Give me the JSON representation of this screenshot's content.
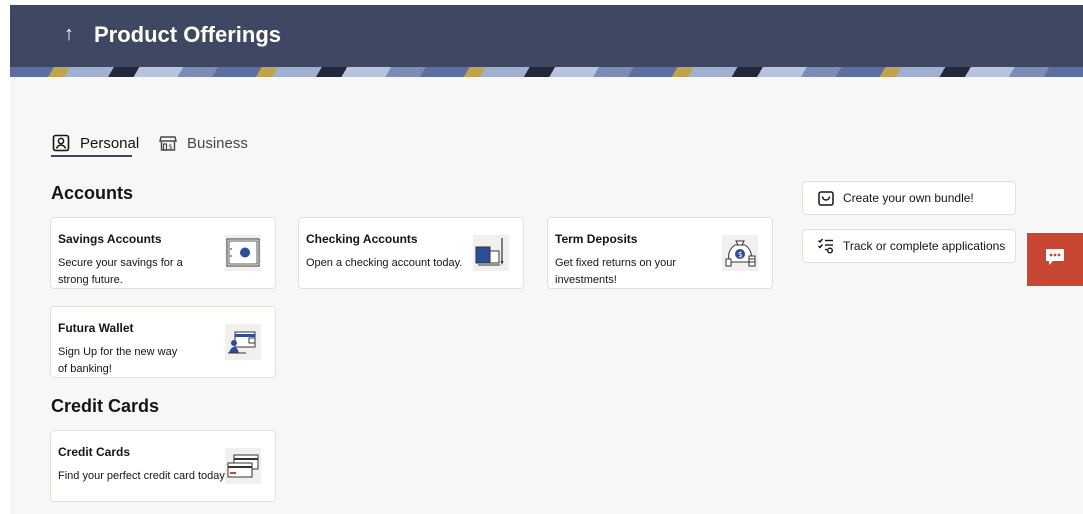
{
  "header": {
    "back_glyph": "↑",
    "title": "Product Offerings"
  },
  "tabs": [
    {
      "label": "Personal",
      "icon": "person-id-icon",
      "selected": true
    },
    {
      "label": "Business",
      "icon": "storefront-icon",
      "selected": false
    }
  ],
  "sections": [
    {
      "title": "Accounts",
      "cards": [
        {
          "title": "Savings Accounts",
          "description": "Secure your savings for a strong future.",
          "icon": "safe-icon"
        },
        {
          "title": "Checking Accounts",
          "description": "Open a checking account today.",
          "icon": "checkbook-icon"
        },
        {
          "title": "Term Deposits",
          "description": "Get fixed returns on your investments!",
          "icon": "money-bag-icon"
        },
        {
          "title": "Futura Wallet",
          "description": "Sign Up for the new way of banking!",
          "icon": "wallet-icon"
        }
      ]
    },
    {
      "title": "Credit Cards",
      "cards": [
        {
          "title": "Credit Cards",
          "description": "Find your perfect credit card today!",
          "icon": "credit-card-icon"
        }
      ]
    }
  ],
  "side_actions": [
    {
      "label": "Create your own bundle!",
      "icon": "shopping-bag-icon"
    },
    {
      "label": "Track or complete applications",
      "icon": "task-list-icon"
    }
  ],
  "chat": {
    "icon": "chat-bubble-icon"
  },
  "colors": {
    "header_bg": "#3f4863",
    "page_bg": "#f8f7f5",
    "chat_bg": "#c74634",
    "icon_blue": "#2b4e9b"
  }
}
